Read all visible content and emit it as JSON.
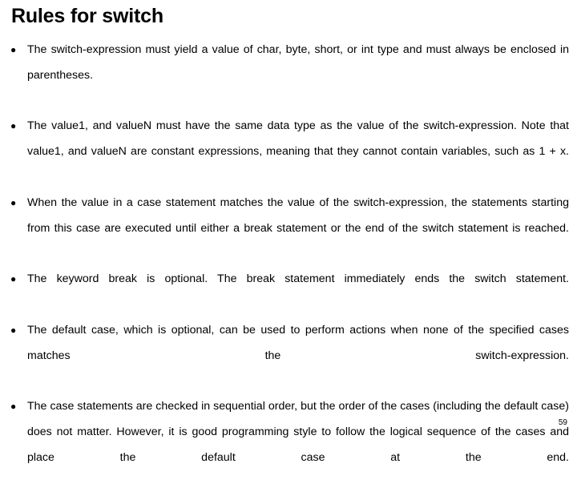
{
  "slide": {
    "title": "Rules for switch",
    "bullet_marker": "●",
    "page_number": "59",
    "bullets": [
      {
        "id": "switch-expression-type",
        "text": "The switch-expression must yield a value of char, byte, short, or int type and must always be enclosed in parentheses."
      },
      {
        "id": "value-constant-expressions",
        "text": "The value1, and valueN must have the same data type as the value of the switch-expression. Note that value1, and valueN are constant expressions, meaning that they cannot contain variables, such as 1 + x."
      },
      {
        "id": "case-match-execution",
        "text": "When the value in a case statement matches the value of the switch-expression, the statements starting from this case are executed until either a break statement or the end of the switch statement is reached."
      },
      {
        "id": "break-optional",
        "text": "The keyword break is optional. The break statement immediately ends the switch statement."
      },
      {
        "id": "default-case-optional",
        "text": "The default case, which is optional, can be used to perform actions when none of the specified cases matches the switch-expression."
      },
      {
        "id": "sequential-order",
        "text": "The case statements are checked in sequential order, but the order of the cases (including the default case) does not matter. However, it is good programming style to follow the logical sequence of the cases and place the default case at the end."
      }
    ]
  },
  "colors": {
    "background": "#ffffff",
    "text": "#000000"
  }
}
